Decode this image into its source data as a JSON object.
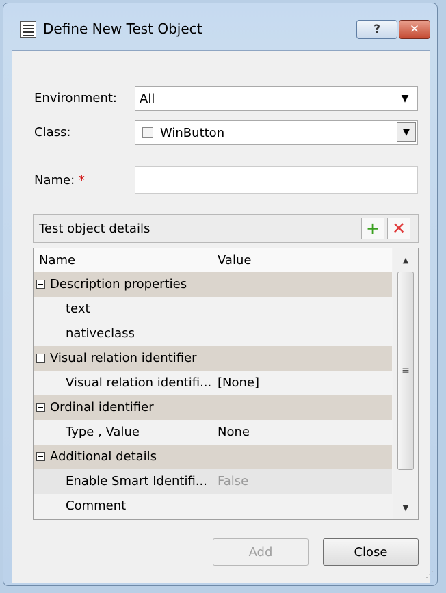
{
  "window": {
    "title": "Define New Test Object",
    "help_label": "?",
    "close_label": "✕"
  },
  "form": {
    "environment_label": "Environment:",
    "environment_value": "All",
    "class_label": "Class:",
    "class_value": "WinButton",
    "name_label": "Name:",
    "name_required": "*",
    "name_value": ""
  },
  "details": {
    "title": "Test object details",
    "add_icon": "+",
    "delete_icon": "✕",
    "columns": {
      "name": "Name",
      "value": "Value"
    },
    "rows": [
      {
        "name": "Description properties",
        "value": ""
      },
      {
        "name": "text",
        "value": ""
      },
      {
        "name": "nativeclass",
        "value": ""
      },
      {
        "name": "Visual relation identifier",
        "value": ""
      },
      {
        "name": "Visual relation identifi...",
        "value": "[None]"
      },
      {
        "name": "Ordinal identifier",
        "value": ""
      },
      {
        "name": "Type , Value",
        "value": "None"
      },
      {
        "name": "Additional details",
        "value": ""
      },
      {
        "name": "Enable Smart Identifi...",
        "value": "False"
      },
      {
        "name": "Comment",
        "value": ""
      }
    ]
  },
  "buttons": {
    "add": "Add",
    "close": "Close"
  },
  "icons": {
    "window_icon": "list-icon",
    "help": "help-icon",
    "close": "close-icon",
    "dropdown": "chevron-down-icon",
    "grip": "resize-grip-icon"
  }
}
